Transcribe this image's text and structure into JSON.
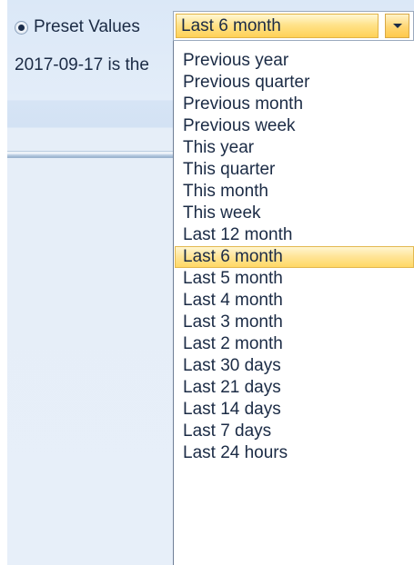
{
  "preset": {
    "label": "Preset Values",
    "selected": "Last 6 month"
  },
  "info": {
    "text": "2017-09-17 is the"
  },
  "dropdown": {
    "items": [
      {
        "label": "Previous year"
      },
      {
        "label": "Previous quarter"
      },
      {
        "label": "Previous month"
      },
      {
        "label": "Previous week"
      },
      {
        "label": "This year"
      },
      {
        "label": "This quarter"
      },
      {
        "label": "This month"
      },
      {
        "label": "This week"
      },
      {
        "label": "Last 12 month"
      },
      {
        "label": "Last 6 month"
      },
      {
        "label": "Last 5 month"
      },
      {
        "label": "Last 4 month"
      },
      {
        "label": "Last 3 month"
      },
      {
        "label": "Last 2 month"
      },
      {
        "label": "Last 30 days"
      },
      {
        "label": "Last 21 days"
      },
      {
        "label": "Last 14 days"
      },
      {
        "label": "Last 7 days"
      },
      {
        "label": "Last 24 hours"
      }
    ]
  },
  "colors": {
    "panel_background": "#e3edf9",
    "highlight_top": "#fff6d2",
    "highlight_bottom": "#ffd865",
    "text": "#1b2b45"
  },
  "icons": {
    "combo_arrow": "chevron-down-icon",
    "radio": "radio-selected-icon"
  }
}
